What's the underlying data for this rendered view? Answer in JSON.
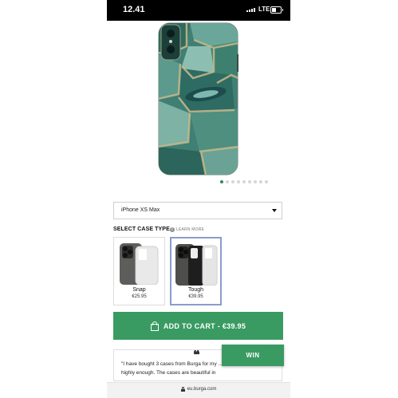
{
  "status_bar": {
    "time": "12.41",
    "network": "LTE",
    "battery_level": 0.5
  },
  "product": {
    "carousel": {
      "total": 9,
      "active": 0
    }
  },
  "model_select": {
    "value": "iPhone XS Max"
  },
  "case_type": {
    "heading": "SELECT CASE TYPE",
    "learn_more": "LEARN MORE",
    "info_glyph": "i",
    "options": [
      {
        "name": "Snap",
        "price": "€25.95",
        "selected": false
      },
      {
        "name": "Tough",
        "price": "€39.95",
        "selected": true
      }
    ]
  },
  "cart": {
    "label": "ADD TO CART  -  €39.95"
  },
  "review": {
    "quote_mark": "❝",
    "text": "\"I have bought 3 cases from Burga for my ... recommend them highly enough. The cases are beautiful in"
  },
  "win_button": {
    "label": "WIN"
  },
  "url_bar": {
    "url": "eu.burga.com"
  },
  "colors": {
    "brand_green": "#3a9b62",
    "selected_border": "#8a9ccc"
  }
}
